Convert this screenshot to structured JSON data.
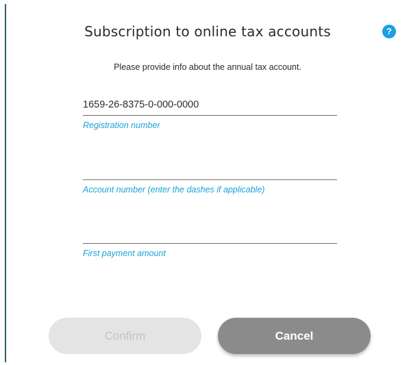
{
  "dialog": {
    "title": "Subscription to online tax accounts",
    "help_icon": "question-mark-icon",
    "help_glyph": "?",
    "subtitle": "Please provide info about the annual tax account."
  },
  "fields": [
    {
      "value": "1659-26-8375-0-000-0000",
      "label": "Registration number"
    },
    {
      "value": "",
      "label": "Account number (enter the dashes if applicable)"
    },
    {
      "value": "",
      "label": "First payment amount"
    }
  ],
  "buttons": {
    "confirm_label": "Confirm",
    "cancel_label": "Cancel"
  },
  "colors": {
    "accent_blue": "#1ba2d9",
    "help_blue": "#1a9fe3",
    "confirm_disabled_bg": "#e4e4e4",
    "cancel_bg": "#8b8b8b"
  }
}
